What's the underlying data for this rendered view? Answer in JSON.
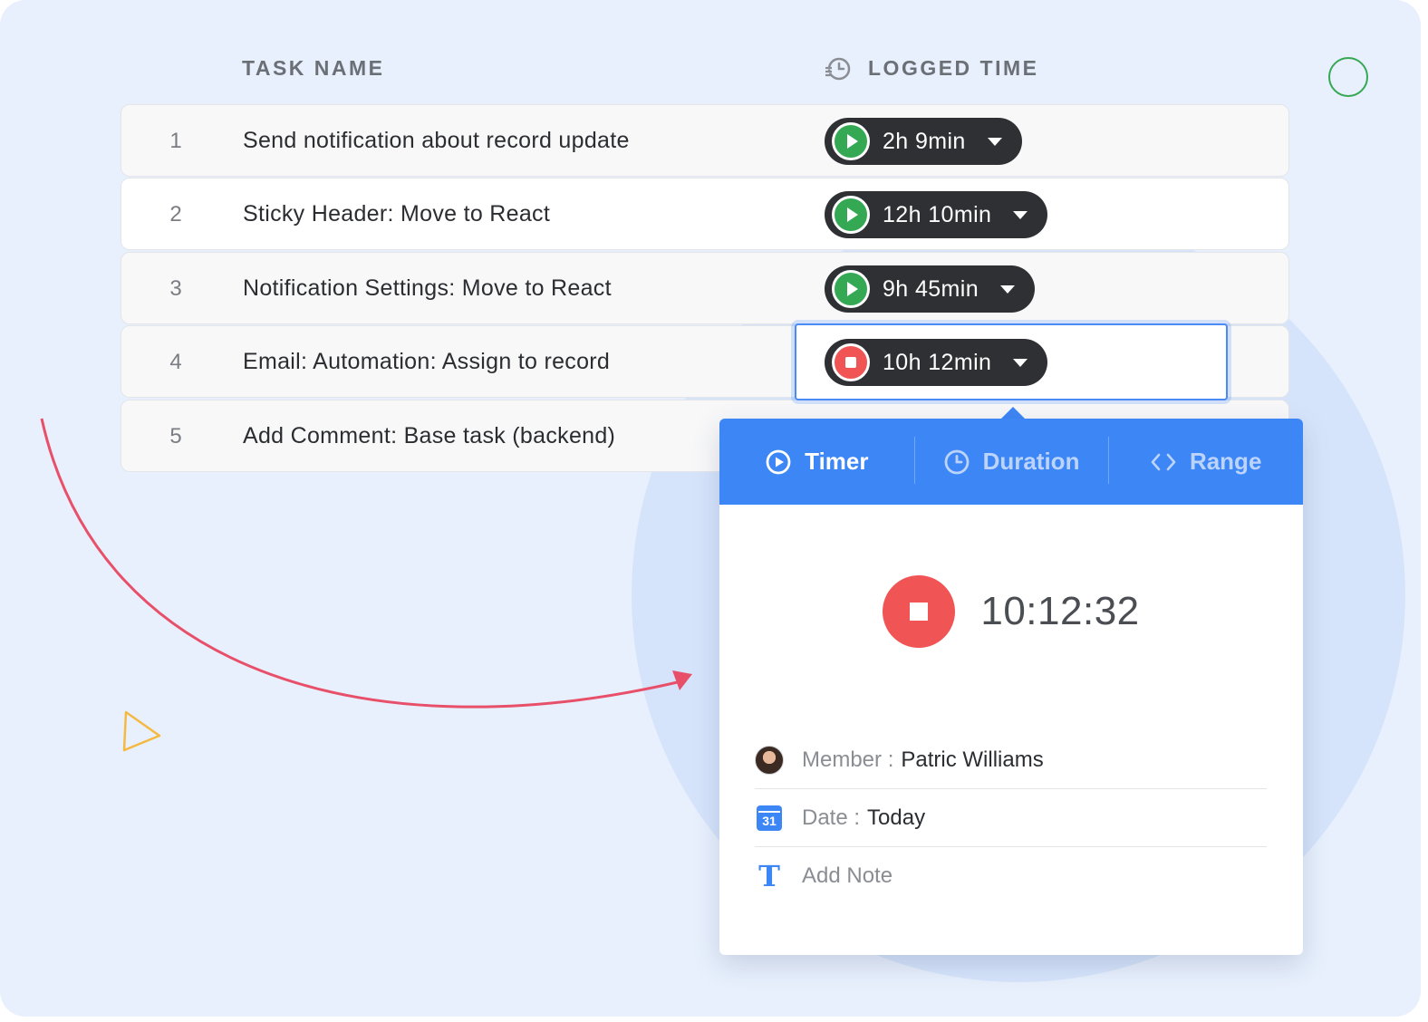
{
  "header": {
    "task_name": "TASK NAME",
    "logged_time": "LOGGED TIME"
  },
  "tasks": [
    {
      "num": "1",
      "name": "Send notification about record update",
      "time": "2h 9min",
      "state": "play"
    },
    {
      "num": "2",
      "name": "Sticky Header: Move to React",
      "time": "12h 10min",
      "state": "play"
    },
    {
      "num": "3",
      "name": "Notification Settings: Move to React",
      "time": "9h 45min",
      "state": "play"
    },
    {
      "num": "4",
      "name": "Email: Automation: Assign to record",
      "time": "10h 12min",
      "state": "stop"
    },
    {
      "num": "5",
      "name": "Add Comment: Base task (backend)",
      "time": "",
      "state": "none"
    }
  ],
  "popup": {
    "tabs": [
      {
        "label": "Timer",
        "icon": "play-circle-icon",
        "active": true
      },
      {
        "label": "Duration",
        "icon": "clock-icon",
        "active": false
      },
      {
        "label": "Range",
        "icon": "code-brackets-icon",
        "active": false
      }
    ],
    "timer_value": "10:12:32",
    "member_label": "Member :",
    "member_value": "Patric Williams",
    "date_label": "Date :",
    "date_value": "Today",
    "calendar_day": "31",
    "note_label": "Add Note",
    "note_icon": "T"
  },
  "colors": {
    "accent": "#3d86f5",
    "play": "#34a853",
    "stop": "#f05454",
    "pill": "#2e3033",
    "background": "#e8f0fd"
  }
}
